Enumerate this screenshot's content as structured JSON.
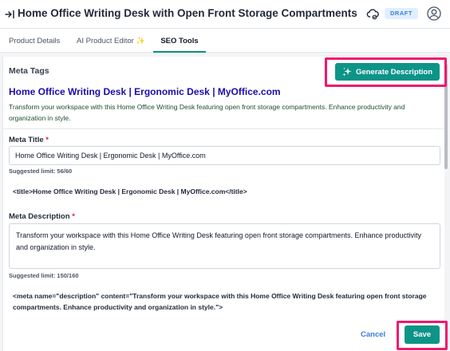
{
  "header": {
    "title": "Home Office Writing Desk with Open Front Storage Compartments",
    "status_badge": "DRAFT"
  },
  "tabs": [
    {
      "label": "Product Details",
      "active": false
    },
    {
      "label": "AI Product Editor",
      "active": false,
      "icon": "sparkle-icon"
    },
    {
      "label": "SEO Tools",
      "active": true
    }
  ],
  "meta_tags": {
    "heading": "Meta Tags",
    "generate_button": "Generate Description",
    "preview_title": "Home Office Writing Desk | Ergonomic Desk | MyOffice.com",
    "preview_description": "Transform your workspace with this Home Office Writing Desk featuring open front storage compartments. Enhance productivity and organization in style."
  },
  "meta_title": {
    "label": "Meta Title",
    "required_marker": "*",
    "value": "Home Office Writing Desk | Ergonomic Desk | MyOffice.com",
    "hint": "Suggested limit: 56/60",
    "code": "<title>Home Office Writing Desk | Ergonomic Desk | MyOffice.com</title>"
  },
  "meta_description": {
    "label": "Meta Description",
    "required_marker": "*",
    "value": "Transform your workspace with this Home Office Writing Desk featuring open front storage compartments. Enhance productivity and organization in style.",
    "hint": "Suggested limit: 150/160",
    "code": "<meta name=\"description\" content=\"Transform your workspace with this Home Office Writing Desk featuring open front storage compartments. Enhance productivity and organization in style.\">"
  },
  "footer": {
    "cancel_label": "Cancel",
    "save_label": "Save"
  },
  "colors": {
    "accent": "#0d9488",
    "link": "#1a0dab",
    "highlight": "#f0186e",
    "badge_bg": "#e0efff"
  }
}
